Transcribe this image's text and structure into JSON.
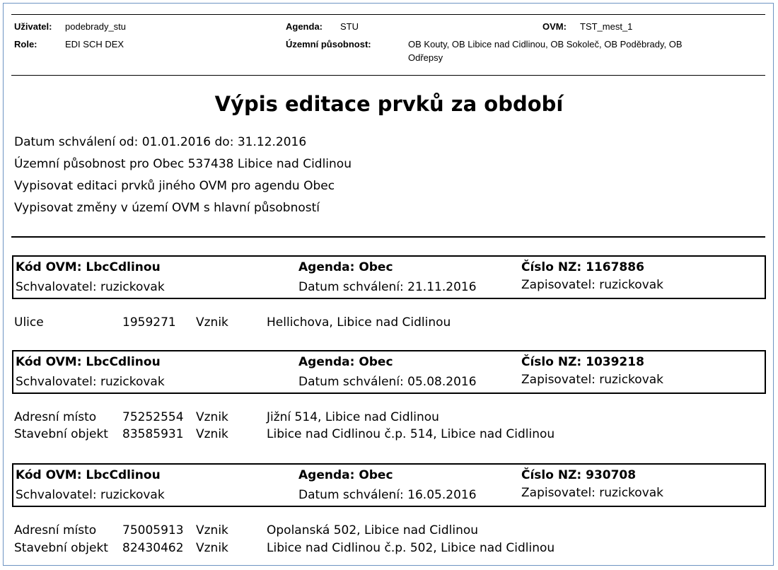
{
  "header": {
    "user_label": "Uživatel:",
    "user_value": "podebrady_stu",
    "role_label": "Role:",
    "role_value": "EDI SCH DEX",
    "agenda_label": "Agenda:",
    "agenda_value": "STU",
    "territory_label": "Územní působnost:",
    "territory_line1": "OB Kouty, OB Libice nad Cidlinou, OB Sokoleč, OB Poděbrady, OB",
    "territory_line2": "Odřepsy",
    "ovm_label": "OVM:",
    "ovm_value": "TST_mest_1"
  },
  "title": "Výpis editace prvků za období",
  "params": [
    "Datum schválení od: 01.01.2016 do: 31.12.2016",
    "Územní působnost pro Obec 537438 Libice nad Cidlinou",
    "Vypisovat editaci prvků jiného OVM pro agendu Obec",
    "Vypisovat změny v území OVM s hlavní působností"
  ],
  "records": [
    {
      "kod_ovm": "Kód OVM: LbcCdlinou",
      "agenda": "Agenda: Obec",
      "cislo_nz": "Číslo NZ: 1167886",
      "schvalovatel": "Schvalovatel: ruzickovak",
      "datum": "Datum schválení: 21.11.2016",
      "zapisovatel": "Zapisovatel: ruzickovak",
      "items": [
        {
          "type": "Ulice",
          "id": "1959271",
          "action": "Vznik",
          "desc": "Hellichova, Libice nad Cidlinou"
        }
      ]
    },
    {
      "kod_ovm": "Kód OVM: LbcCdlinou",
      "agenda": "Agenda: Obec",
      "cislo_nz": "Číslo NZ: 1039218",
      "schvalovatel": "Schvalovatel: ruzickovak",
      "datum": "Datum schválení: 05.08.2016",
      "zapisovatel": "Zapisovatel: ruzickovak",
      "items": [
        {
          "type": "Adresní místo",
          "id": "75252554",
          "action": "Vznik",
          "desc": "Jižní 514, Libice nad Cidlinou"
        },
        {
          "type": "Stavební objekt",
          "id": "83585931",
          "action": "Vznik",
          "desc": "Libice nad Cidlinou č.p. 514, Libice nad Cidlinou"
        }
      ]
    },
    {
      "kod_ovm": "Kód OVM: LbcCdlinou",
      "agenda": "Agenda: Obec",
      "cislo_nz": "Číslo NZ: 930708",
      "schvalovatel": "Schvalovatel: ruzickovak",
      "datum": "Datum schválení: 16.05.2016",
      "zapisovatel": "Zapisovatel: ruzickovak",
      "items": [
        {
          "type": "Adresní místo",
          "id": "75005913",
          "action": "Vznik",
          "desc": "Opolanská 502, Libice nad Cidlinou"
        },
        {
          "type": "Stavební objekt",
          "id": "82430462",
          "action": "Vznik",
          "desc": "Libice nad Cidlinou č.p. 502, Libice nad Cidlinou"
        }
      ]
    }
  ]
}
